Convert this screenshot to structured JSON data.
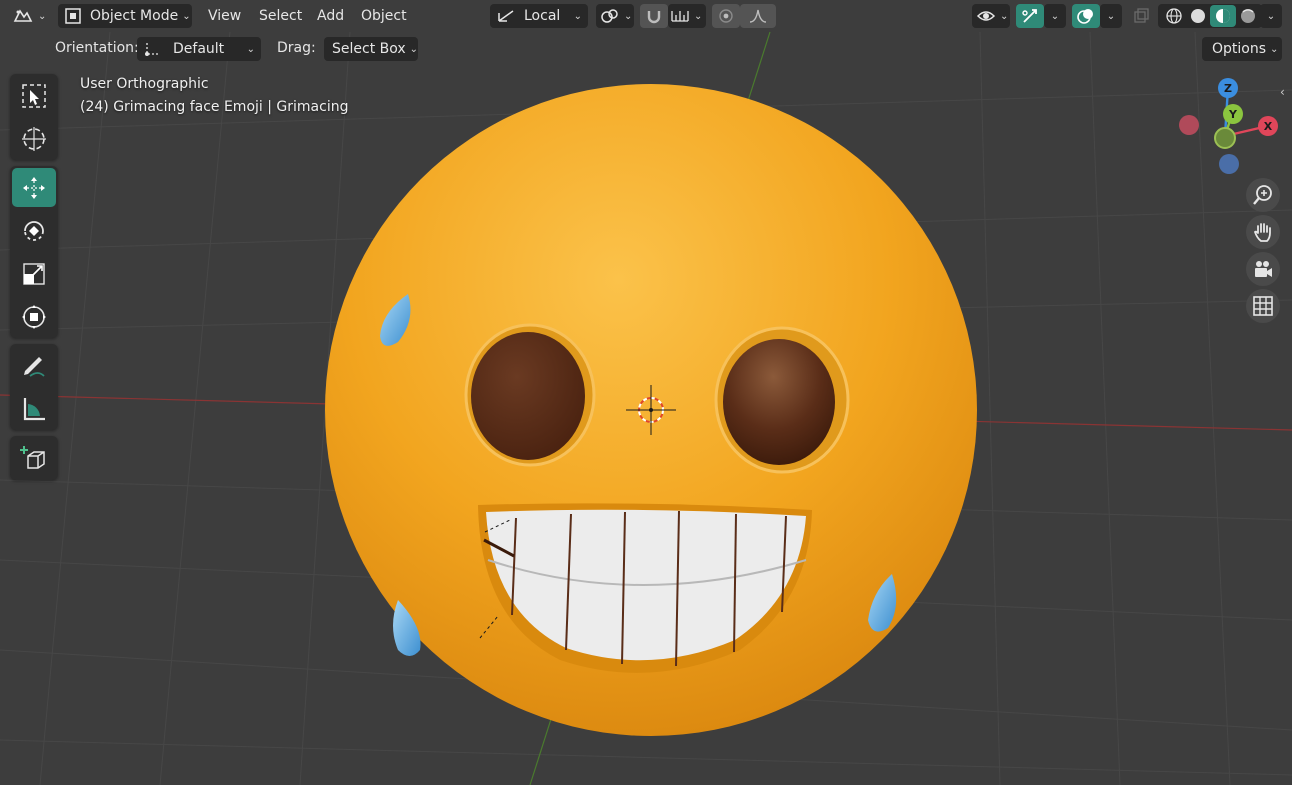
{
  "header": {
    "mode_label": "Object Mode",
    "menus": [
      "View",
      "Select",
      "Add",
      "Object"
    ],
    "transform_space_label": "Local"
  },
  "tool_header": {
    "orientation_label": "Orientation:",
    "orientation_value": "Default",
    "drag_label": "Drag:",
    "drag_value": "Select Box",
    "options_label": "Options"
  },
  "viewport": {
    "view_name": "User Orthographic",
    "object_info": "(24) Grimacing face Emoji | Grimacing"
  },
  "gizmo": {
    "z_label": "Z",
    "y_label": "Y",
    "x_label": "X",
    "colors": {
      "x": "#e0465a",
      "y": "#8bc53f",
      "z": "#3b8ee0",
      "neg_x": "#b04a5a",
      "neg_y": "#6a8a3a",
      "neg_z": "#4a6ea8"
    }
  },
  "colors": {
    "accent": "#2f8a78",
    "face": "#f2a51f",
    "eye": "#5a2d18",
    "tear": "#5aa8e0",
    "teeth": "#ececec"
  },
  "toolbar_icons": [
    "select-box-icon",
    "cursor-icon",
    "move-icon",
    "rotate-icon",
    "scale-icon",
    "transform-icon",
    "annotate-icon",
    "measure-icon",
    "add-cube-icon"
  ],
  "nav_icons": [
    "zoom-icon",
    "pan-hand-icon",
    "camera-icon",
    "grid-icon"
  ]
}
